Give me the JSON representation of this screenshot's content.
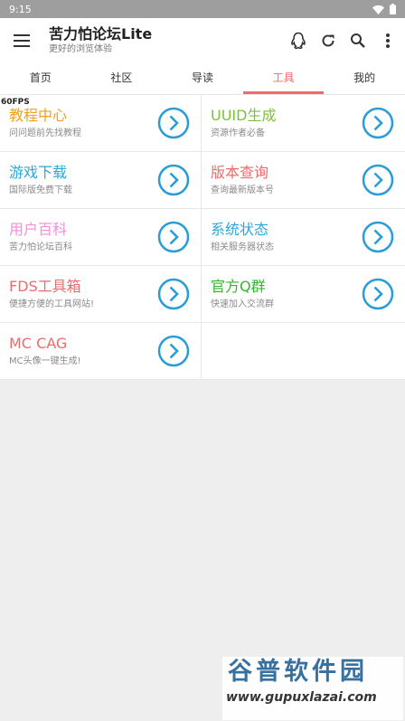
{
  "status_bar": {
    "time": "9:15"
  },
  "app_bar": {
    "title": "苦力怕论坛Lite",
    "subtitle": "更好的浏览体验"
  },
  "tabs": [
    "首页",
    "社区",
    "导读",
    "工具",
    "我的"
  ],
  "fps": "60FPS",
  "colors": {
    "accent": "#ef6a6a",
    "arrow": "#2a9dd8"
  },
  "tools": [
    {
      "title": "教程中心",
      "subtitle": "问问题前先找教程",
      "color": "#f0a020"
    },
    {
      "title": "UUID生成",
      "subtitle": "资源作者必备",
      "color": "#7cc13a"
    },
    {
      "title": "游戏下载",
      "subtitle": "国际版免费下载",
      "color": "#2aa8dc"
    },
    {
      "title": "版本查询",
      "subtitle": "查询最新版本号",
      "color": "#ef6a6a"
    },
    {
      "title": "用户百科",
      "subtitle": "苦力怕论坛百科",
      "color": "#f48ed8"
    },
    {
      "title": "系统状态",
      "subtitle": "相关服务器状态",
      "color": "#2aa8dc"
    },
    {
      "title": "FDS工具箱",
      "subtitle": "便捷方便的工具网站!",
      "color": "#ef6a6a"
    },
    {
      "title": "官方Q群",
      "subtitle": "快速加入交流群",
      "color": "#2eb82e"
    },
    {
      "title": "MC CAG",
      "subtitle": "MC头像一键生成!",
      "color": "#ef6a6a"
    }
  ],
  "watermark": {
    "title": "谷普软件园",
    "url": "www.gupuxlazai.com"
  }
}
